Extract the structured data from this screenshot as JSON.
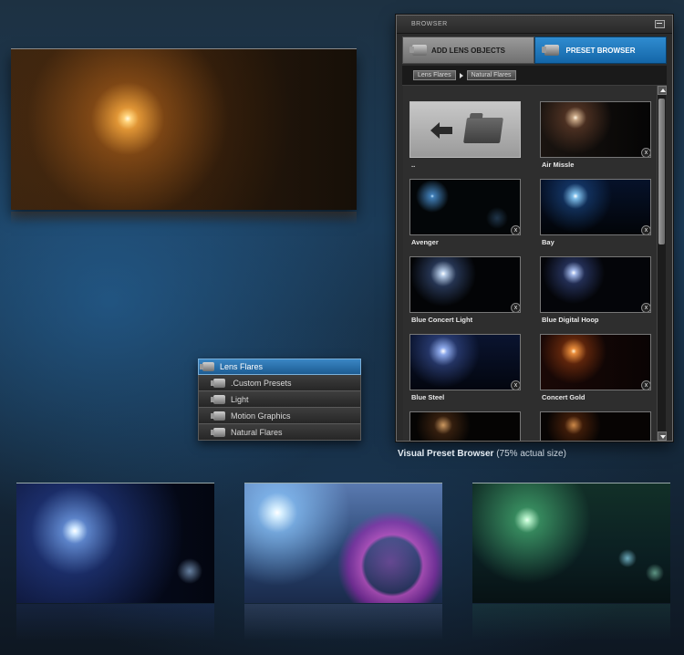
{
  "browser": {
    "title": "BROWSER",
    "tabs": [
      {
        "label": "ADD LENS OBJECTS"
      },
      {
        "label": "PRESET BROWSER"
      }
    ],
    "breadcrumb": [
      "Lens Flares",
      "Natural Flares"
    ],
    "back_label": "..",
    "presets": [
      {
        "label": "Air Missle",
        "delete": "x",
        "color": "#f0c8a0"
      },
      {
        "label": "Avenger",
        "delete": "x",
        "color": "#5ab0ff"
      },
      {
        "label": "Bay",
        "delete": "x",
        "color": "#8ad0ff"
      },
      {
        "label": "Blue Concert Light",
        "delete": "x",
        "color": "#c8e0ff"
      },
      {
        "label": "Blue Digital Hoop",
        "delete": "x",
        "color": "#b0c8ff"
      },
      {
        "label": "Blue Steel",
        "delete": "x",
        "color": "#9ab8ff"
      },
      {
        "label": "Concert Gold",
        "delete": "x",
        "color": "#ff9a40"
      }
    ]
  },
  "caption": {
    "bold": "Visual Preset Browser",
    "rest": " (75% actual size)"
  },
  "tree": {
    "items": [
      {
        "label": "Lens Flares"
      },
      {
        "label": ".Custom Presets"
      },
      {
        "label": "Light"
      },
      {
        "label": "Motion Graphics"
      },
      {
        "label": "Natural Flares"
      }
    ]
  },
  "colors": {
    "accent": "#1f6fb0",
    "panel_bg": "#2b2b2b"
  }
}
